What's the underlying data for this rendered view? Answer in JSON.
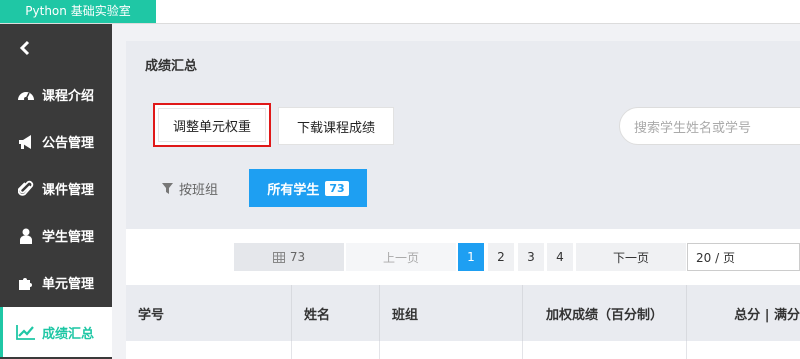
{
  "app": {
    "tab_title": "Python 基础实验室"
  },
  "sidebar": {
    "back_icon": "chevron-left-icon",
    "items": [
      {
        "label": "课程介绍",
        "icon": "dashboard-icon"
      },
      {
        "label": "公告管理",
        "icon": "bullhorn-icon"
      },
      {
        "label": "课件管理",
        "icon": "paperclip-icon"
      },
      {
        "label": "学生管理",
        "icon": "user-icon"
      },
      {
        "label": "单元管理",
        "icon": "puzzle-icon"
      },
      {
        "label": "成绩汇总",
        "icon": "line-chart-icon",
        "active": true
      }
    ]
  },
  "main": {
    "title": "成绩汇总",
    "adjust_button": "调整单元权重",
    "download_button": "下载课程成绩",
    "search_placeholder": "搜索学生姓名或学号",
    "filter_button": "按班组",
    "all_students_button": "所有学生",
    "all_students_count": "73",
    "pager": {
      "count": "73",
      "prev": "上一页",
      "pages": [
        "1",
        "2",
        "3",
        "4"
      ],
      "current_page": "1",
      "next": "下一页",
      "page_size": "20 / 页"
    },
    "table": {
      "headers": [
        "学号",
        "姓名",
        "班组",
        "加权成绩（百分制）",
        "总分 | 满分"
      ]
    }
  },
  "colors": {
    "accent": "#1fc7a5",
    "primary": "#1e9ff2",
    "highlight": "#e01818",
    "sidebar": "#3a3a3a"
  }
}
